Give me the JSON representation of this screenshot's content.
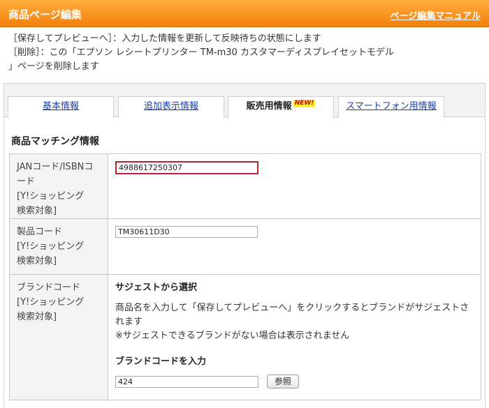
{
  "header": {
    "title": "商品ページ編集",
    "manual_link": "ページ編集マニュアル"
  },
  "notice": {
    "line1": "［保存してプレビューへ］：入力した情報を更新して反映待ちの状態にします",
    "line2": "［削除］：この「エプソン レシートプリンター TM-m30 カスタマーディスプレイセットモデル",
    "line3": "」ページを削除します"
  },
  "tabs": [
    {
      "label": "基本情報",
      "active": false
    },
    {
      "label": "追加表示情報",
      "active": false
    },
    {
      "label": "販売用情報",
      "active": true,
      "badge": "NEW!"
    },
    {
      "label": "スマートフォン用情報",
      "active": false
    }
  ],
  "section": {
    "title": "商品マッチング情報"
  },
  "rows": {
    "jan": {
      "label_line1": "JANコード/ISBNコ",
      "label_line2": "ード",
      "label_line3": "[Y!ショッピング",
      "label_line4": "検索対象]",
      "value": "4988617250307"
    },
    "product_code": {
      "label_line1": "製品コード",
      "label_line2": "[Y!ショッピング",
      "label_line3": "検索対象]",
      "value": "TM30611D30"
    },
    "brand_code": {
      "label_line1": "ブランドコード",
      "label_line2": "[Y!ショッピング",
      "label_line3": "検索対象]",
      "suggest_title": "サジェストから選択",
      "suggest_desc1": "商品名を入力して「保存してプレビューへ」をクリックするとブランドがサジェストさ",
      "suggest_desc2": "れます",
      "suggest_note": "※サジェストできるブランドがない場合は表示されません",
      "input_title": "ブランドコードを入力",
      "value": "424",
      "browse_button": "参照"
    }
  },
  "colors": {
    "header_orange": "#f47f0d",
    "link_blue": "#1a3fa8",
    "highlight_red": "#c2202e",
    "badge_yellow": "#ffef2f"
  }
}
